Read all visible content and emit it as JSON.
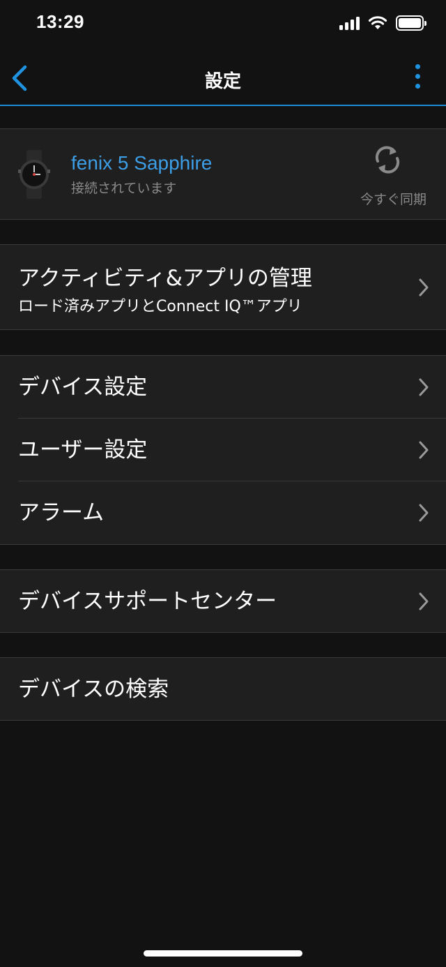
{
  "status_bar": {
    "time": "13:29"
  },
  "nav": {
    "title": "設定"
  },
  "device": {
    "name": "fenix 5 Sapphire",
    "status": "接続されています",
    "sync_label": "今すぐ同期"
  },
  "apps": {
    "title": "アクティビティ&アプリの管理",
    "subtitle": "ロード済みアプリとConnect IQ™アプリ"
  },
  "settings": {
    "items": [
      {
        "label": "デバイス設定"
      },
      {
        "label": "ユーザー設定"
      },
      {
        "label": "アラーム"
      }
    ]
  },
  "support": {
    "label": "デバイスサポートセンター"
  },
  "search": {
    "label": "デバイスの検索"
  },
  "colors": {
    "accent": "#1f93e0",
    "device_name": "#3d9ee6",
    "background": "#121212",
    "cell": "#1f1f1f"
  }
}
